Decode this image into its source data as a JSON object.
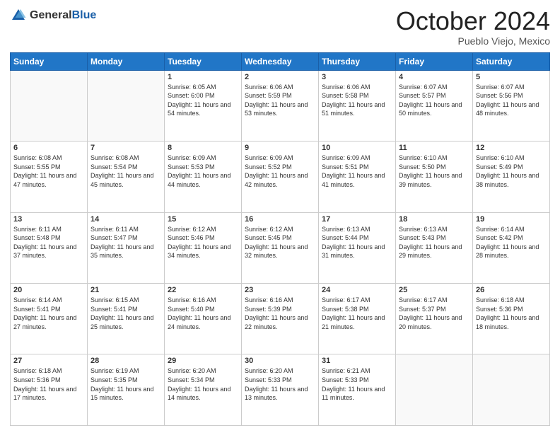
{
  "logo": {
    "general": "General",
    "blue": "Blue"
  },
  "title": "October 2024",
  "location": "Pueblo Viejo, Mexico",
  "weekdays": [
    "Sunday",
    "Monday",
    "Tuesday",
    "Wednesday",
    "Thursday",
    "Friday",
    "Saturday"
  ],
  "weeks": [
    [
      {
        "day": "",
        "info": ""
      },
      {
        "day": "",
        "info": ""
      },
      {
        "day": "1",
        "sunrise": "6:05 AM",
        "sunset": "6:00 PM",
        "daylight": "11 hours and 54 minutes."
      },
      {
        "day": "2",
        "sunrise": "6:06 AM",
        "sunset": "5:59 PM",
        "daylight": "11 hours and 53 minutes."
      },
      {
        "day": "3",
        "sunrise": "6:06 AM",
        "sunset": "5:58 PM",
        "daylight": "11 hours and 51 minutes."
      },
      {
        "day": "4",
        "sunrise": "6:07 AM",
        "sunset": "5:57 PM",
        "daylight": "11 hours and 50 minutes."
      },
      {
        "day": "5",
        "sunrise": "6:07 AM",
        "sunset": "5:56 PM",
        "daylight": "11 hours and 48 minutes."
      }
    ],
    [
      {
        "day": "6",
        "sunrise": "6:08 AM",
        "sunset": "5:55 PM",
        "daylight": "11 hours and 47 minutes."
      },
      {
        "day": "7",
        "sunrise": "6:08 AM",
        "sunset": "5:54 PM",
        "daylight": "11 hours and 45 minutes."
      },
      {
        "day": "8",
        "sunrise": "6:09 AM",
        "sunset": "5:53 PM",
        "daylight": "11 hours and 44 minutes."
      },
      {
        "day": "9",
        "sunrise": "6:09 AM",
        "sunset": "5:52 PM",
        "daylight": "11 hours and 42 minutes."
      },
      {
        "day": "10",
        "sunrise": "6:09 AM",
        "sunset": "5:51 PM",
        "daylight": "11 hours and 41 minutes."
      },
      {
        "day": "11",
        "sunrise": "6:10 AM",
        "sunset": "5:50 PM",
        "daylight": "11 hours and 39 minutes."
      },
      {
        "day": "12",
        "sunrise": "6:10 AM",
        "sunset": "5:49 PM",
        "daylight": "11 hours and 38 minutes."
      }
    ],
    [
      {
        "day": "13",
        "sunrise": "6:11 AM",
        "sunset": "5:48 PM",
        "daylight": "11 hours and 37 minutes."
      },
      {
        "day": "14",
        "sunrise": "6:11 AM",
        "sunset": "5:47 PM",
        "daylight": "11 hours and 35 minutes."
      },
      {
        "day": "15",
        "sunrise": "6:12 AM",
        "sunset": "5:46 PM",
        "daylight": "11 hours and 34 minutes."
      },
      {
        "day": "16",
        "sunrise": "6:12 AM",
        "sunset": "5:45 PM",
        "daylight": "11 hours and 32 minutes."
      },
      {
        "day": "17",
        "sunrise": "6:13 AM",
        "sunset": "5:44 PM",
        "daylight": "11 hours and 31 minutes."
      },
      {
        "day": "18",
        "sunrise": "6:13 AM",
        "sunset": "5:43 PM",
        "daylight": "11 hours and 29 minutes."
      },
      {
        "day": "19",
        "sunrise": "6:14 AM",
        "sunset": "5:42 PM",
        "daylight": "11 hours and 28 minutes."
      }
    ],
    [
      {
        "day": "20",
        "sunrise": "6:14 AM",
        "sunset": "5:41 PM",
        "daylight": "11 hours and 27 minutes."
      },
      {
        "day": "21",
        "sunrise": "6:15 AM",
        "sunset": "5:41 PM",
        "daylight": "11 hours and 25 minutes."
      },
      {
        "day": "22",
        "sunrise": "6:16 AM",
        "sunset": "5:40 PM",
        "daylight": "11 hours and 24 minutes."
      },
      {
        "day": "23",
        "sunrise": "6:16 AM",
        "sunset": "5:39 PM",
        "daylight": "11 hours and 22 minutes."
      },
      {
        "day": "24",
        "sunrise": "6:17 AM",
        "sunset": "5:38 PM",
        "daylight": "11 hours and 21 minutes."
      },
      {
        "day": "25",
        "sunrise": "6:17 AM",
        "sunset": "5:37 PM",
        "daylight": "11 hours and 20 minutes."
      },
      {
        "day": "26",
        "sunrise": "6:18 AM",
        "sunset": "5:36 PM",
        "daylight": "11 hours and 18 minutes."
      }
    ],
    [
      {
        "day": "27",
        "sunrise": "6:18 AM",
        "sunset": "5:36 PM",
        "daylight": "11 hours and 17 minutes."
      },
      {
        "day": "28",
        "sunrise": "6:19 AM",
        "sunset": "5:35 PM",
        "daylight": "11 hours and 15 minutes."
      },
      {
        "day": "29",
        "sunrise": "6:20 AM",
        "sunset": "5:34 PM",
        "daylight": "11 hours and 14 minutes."
      },
      {
        "day": "30",
        "sunrise": "6:20 AM",
        "sunset": "5:33 PM",
        "daylight": "11 hours and 13 minutes."
      },
      {
        "day": "31",
        "sunrise": "6:21 AM",
        "sunset": "5:33 PM",
        "daylight": "11 hours and 11 minutes."
      },
      {
        "day": "",
        "info": ""
      },
      {
        "day": "",
        "info": ""
      }
    ]
  ],
  "labels": {
    "sunrise": "Sunrise:",
    "sunset": "Sunset:",
    "daylight": "Daylight:"
  }
}
